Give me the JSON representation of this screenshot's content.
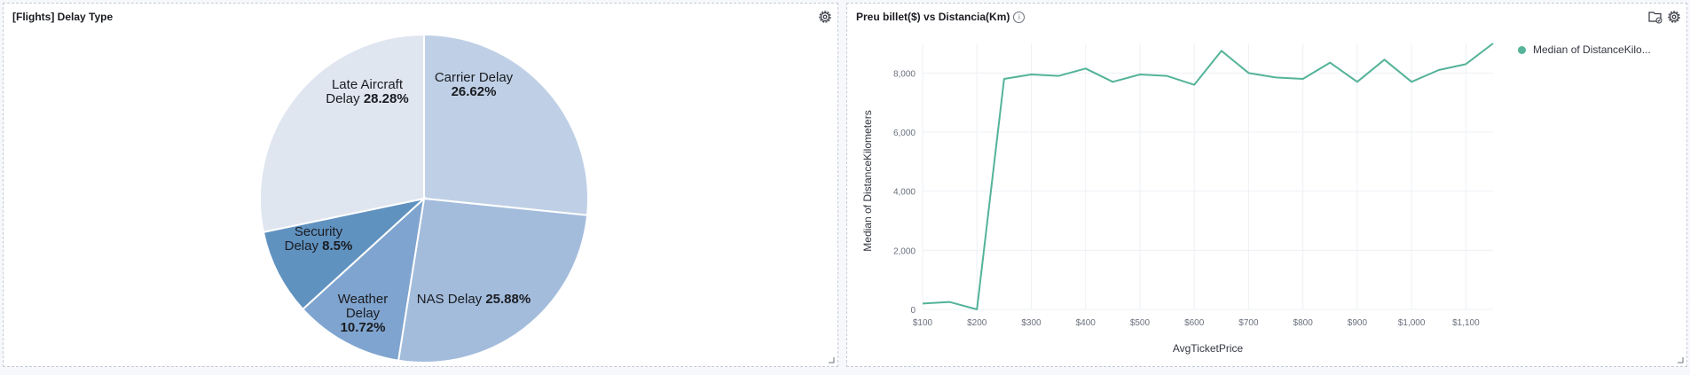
{
  "panels": {
    "left": {
      "title": "[Flights] Delay Type"
    },
    "right": {
      "title": "Preu billet($) vs Distancia(Km)"
    }
  },
  "icons": {
    "gear": "gear-icon",
    "folder": "folder-check-icon",
    "info": "info-icon",
    "resize": "resize-handle-icon"
  },
  "colors": {
    "pie": [
      "#bfd0e6",
      "#a3bcdc",
      "#7fa4cf",
      "#6092c0",
      "#dfe6f0"
    ],
    "line": "#54b399",
    "grid": "#eef0f5",
    "axis_text": "#69707d"
  },
  "chart_data": [
    {
      "type": "pie",
      "title": "[Flights] Delay Type",
      "slices": [
        {
          "label": "Carrier Delay",
          "value": 26.62,
          "display": "26.62%"
        },
        {
          "label": "NAS Delay",
          "value": 25.88,
          "display": "25.88%"
        },
        {
          "label": "Weather Delay",
          "value": 10.72,
          "display": "10.72%"
        },
        {
          "label": "Security Delay",
          "value": 8.5,
          "display": "8.5%"
        },
        {
          "label": "Late Aircraft Delay",
          "value": 28.28,
          "display": "28.28%"
        }
      ]
    },
    {
      "type": "line",
      "title": "Preu billet($) vs Distancia(Km)",
      "xlabel": "AvgTicketPrice",
      "ylabel": "Median of DistanceKilometers",
      "xlim": [
        100,
        1150
      ],
      "ylim": [
        0,
        9000
      ],
      "grid": true,
      "legend_position": "top-right",
      "x_ticks": [
        100,
        200,
        300,
        400,
        500,
        600,
        700,
        800,
        900,
        1000,
        1100
      ],
      "x_tick_labels": [
        "$100",
        "$200",
        "$300",
        "$400",
        "$500",
        "$600",
        "$700",
        "$800",
        "$900",
        "$1,000",
        "$1,100"
      ],
      "y_ticks": [
        0,
        2000,
        4000,
        6000,
        8000
      ],
      "y_tick_labels": [
        "0",
        "2,000",
        "4,000",
        "6,000",
        "8,000"
      ],
      "series": [
        {
          "name": "Median of DistanceKilo...",
          "x": [
            100,
            150,
            200,
            250,
            300,
            350,
            400,
            450,
            500,
            550,
            600,
            650,
            700,
            750,
            800,
            850,
            900,
            950,
            1000,
            1050,
            1100,
            1150
          ],
          "y": [
            200,
            250,
            0,
            7800,
            7950,
            7900,
            8150,
            7700,
            7950,
            7900,
            7600,
            8750,
            8000,
            7850,
            7800,
            8350,
            7700,
            8450,
            7700,
            8100,
            8300,
            9000
          ]
        }
      ]
    }
  ]
}
